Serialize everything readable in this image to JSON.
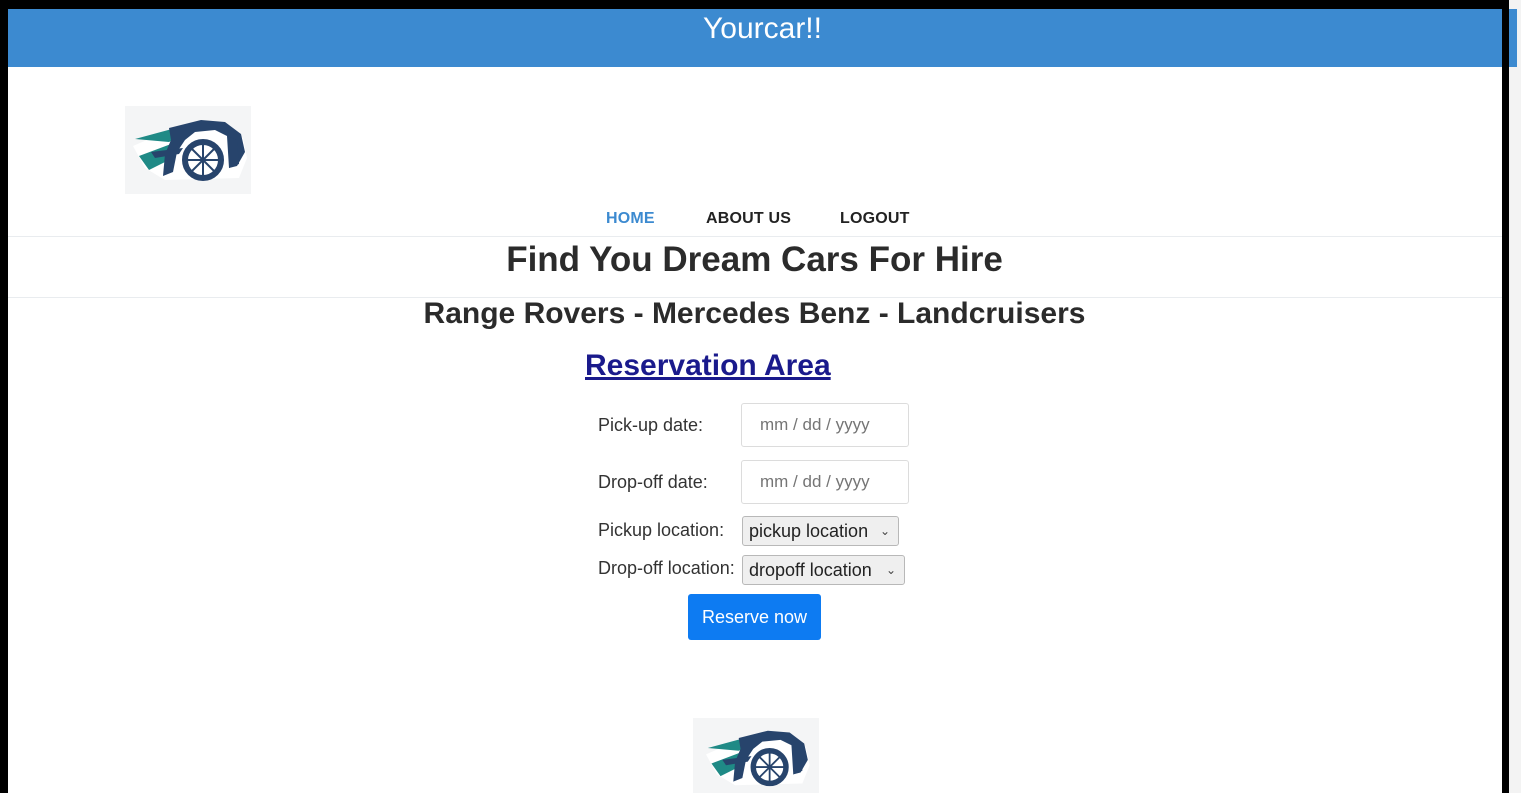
{
  "site": {
    "title": "Yourcar!!"
  },
  "nav": {
    "items": [
      "HOME",
      "ABOUT US",
      "LOGOUT"
    ],
    "active": "HOME"
  },
  "hero": {
    "heading": "Find You Dream Cars For Hire",
    "subheading": "Range Rovers - Mercedes Benz - Landcruisers",
    "section_title": "Reservation Area"
  },
  "form": {
    "pickup_date_label": "Pick-up date:",
    "pickup_date_placeholder": "mm / dd / yyyy",
    "dropoff_date_label": "Drop-off date:",
    "dropoff_date_placeholder": "mm / dd / yyyy",
    "pickup_location_label": "Pickup location:",
    "pickup_location_value": "pickup location",
    "dropoff_location_label": "Drop-off location:",
    "dropoff_location_value": "dropoff location",
    "submit_label": "Reserve now"
  },
  "icons": {
    "logo": "car-logo-icon",
    "chevron": "chevron-down-icon"
  },
  "colors": {
    "topbar": "#3c8ad0",
    "nav_active": "#3c8ad0",
    "section_title": "#1a1a8c",
    "button": "#0d7bf2"
  }
}
